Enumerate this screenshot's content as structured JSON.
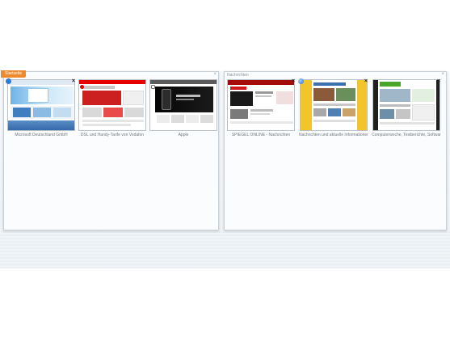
{
  "colors": {
    "group_tag": "#ee8a2e",
    "band": "#eef2f5"
  },
  "groups": [
    {
      "tag": "Startseite",
      "tabs": [
        {
          "label": "Microsoft Deutschland GmbH",
          "icon": "ie-favicon-icon",
          "close": "×"
        },
        {
          "label": "DSL und Handy-Tarife von Vodafon",
          "icon": "vodafone-favicon-icon",
          "close": "×"
        },
        {
          "label": "Apple",
          "icon": "apple-favicon-icon",
          "close": "×"
        }
      ],
      "close": "×"
    },
    {
      "title": "Nachrichten",
      "tabs": [
        {
          "label": "SPIEGEL ONLINE - Nachrichten",
          "icon": "spiegel-favicon-icon",
          "close": "×"
        },
        {
          "label": "Nachrichten und aktuelle Informationen",
          "icon": "globe-favicon-icon",
          "close": "×"
        },
        {
          "label": "Computerwoche, Testberichte, Softwar",
          "icon": "cw-favicon-icon",
          "close": "×"
        }
      ],
      "close": "×"
    }
  ]
}
